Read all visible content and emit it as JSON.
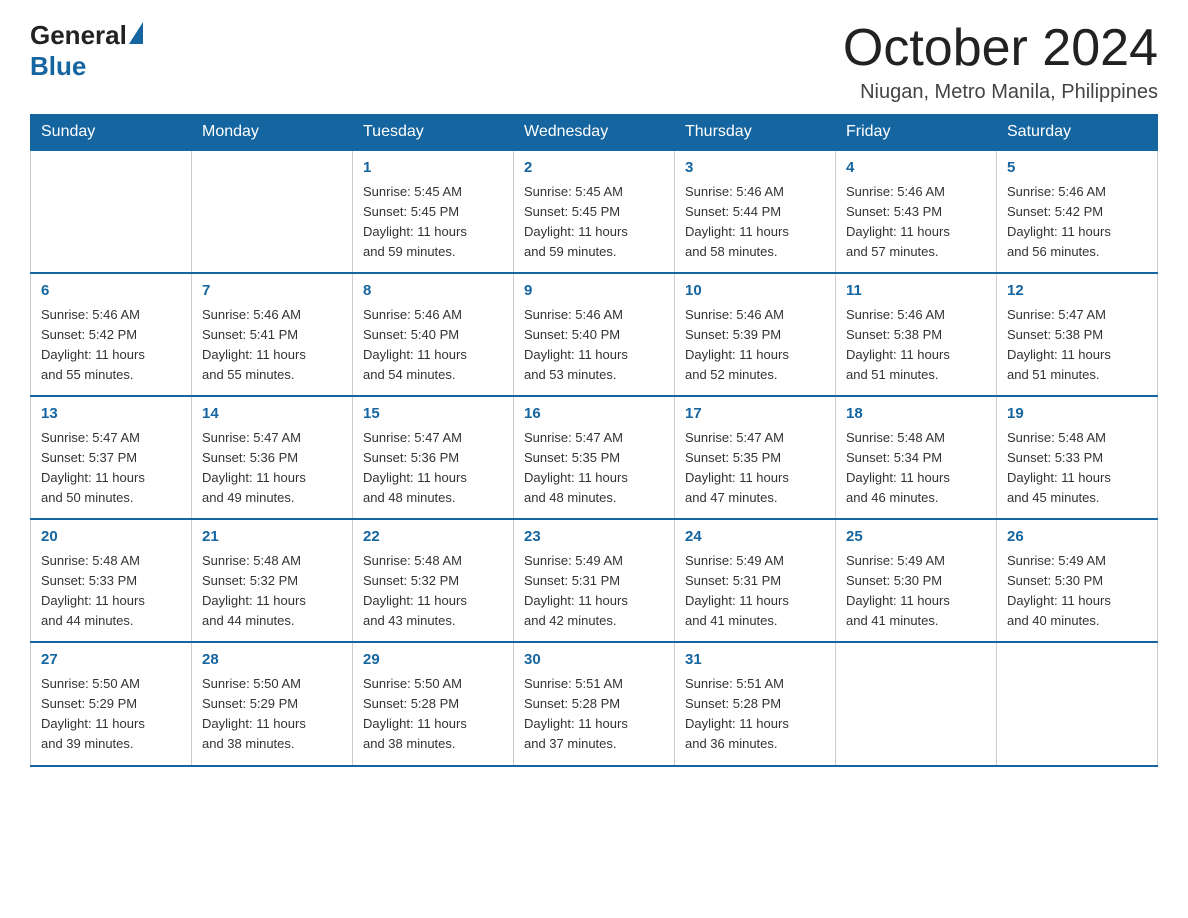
{
  "header": {
    "logo_general": "General",
    "logo_blue": "Blue",
    "month_title": "October 2024",
    "location": "Niugan, Metro Manila, Philippines"
  },
  "weekdays": [
    "Sunday",
    "Monday",
    "Tuesday",
    "Wednesday",
    "Thursday",
    "Friday",
    "Saturday"
  ],
  "weeks": [
    [
      {
        "day": "",
        "info": ""
      },
      {
        "day": "",
        "info": ""
      },
      {
        "day": "1",
        "info": "Sunrise: 5:45 AM\nSunset: 5:45 PM\nDaylight: 11 hours\nand 59 minutes."
      },
      {
        "day": "2",
        "info": "Sunrise: 5:45 AM\nSunset: 5:45 PM\nDaylight: 11 hours\nand 59 minutes."
      },
      {
        "day": "3",
        "info": "Sunrise: 5:46 AM\nSunset: 5:44 PM\nDaylight: 11 hours\nand 58 minutes."
      },
      {
        "day": "4",
        "info": "Sunrise: 5:46 AM\nSunset: 5:43 PM\nDaylight: 11 hours\nand 57 minutes."
      },
      {
        "day": "5",
        "info": "Sunrise: 5:46 AM\nSunset: 5:42 PM\nDaylight: 11 hours\nand 56 minutes."
      }
    ],
    [
      {
        "day": "6",
        "info": "Sunrise: 5:46 AM\nSunset: 5:42 PM\nDaylight: 11 hours\nand 55 minutes."
      },
      {
        "day": "7",
        "info": "Sunrise: 5:46 AM\nSunset: 5:41 PM\nDaylight: 11 hours\nand 55 minutes."
      },
      {
        "day": "8",
        "info": "Sunrise: 5:46 AM\nSunset: 5:40 PM\nDaylight: 11 hours\nand 54 minutes."
      },
      {
        "day": "9",
        "info": "Sunrise: 5:46 AM\nSunset: 5:40 PM\nDaylight: 11 hours\nand 53 minutes."
      },
      {
        "day": "10",
        "info": "Sunrise: 5:46 AM\nSunset: 5:39 PM\nDaylight: 11 hours\nand 52 minutes."
      },
      {
        "day": "11",
        "info": "Sunrise: 5:46 AM\nSunset: 5:38 PM\nDaylight: 11 hours\nand 51 minutes."
      },
      {
        "day": "12",
        "info": "Sunrise: 5:47 AM\nSunset: 5:38 PM\nDaylight: 11 hours\nand 51 minutes."
      }
    ],
    [
      {
        "day": "13",
        "info": "Sunrise: 5:47 AM\nSunset: 5:37 PM\nDaylight: 11 hours\nand 50 minutes."
      },
      {
        "day": "14",
        "info": "Sunrise: 5:47 AM\nSunset: 5:36 PM\nDaylight: 11 hours\nand 49 minutes."
      },
      {
        "day": "15",
        "info": "Sunrise: 5:47 AM\nSunset: 5:36 PM\nDaylight: 11 hours\nand 48 minutes."
      },
      {
        "day": "16",
        "info": "Sunrise: 5:47 AM\nSunset: 5:35 PM\nDaylight: 11 hours\nand 48 minutes."
      },
      {
        "day": "17",
        "info": "Sunrise: 5:47 AM\nSunset: 5:35 PM\nDaylight: 11 hours\nand 47 minutes."
      },
      {
        "day": "18",
        "info": "Sunrise: 5:48 AM\nSunset: 5:34 PM\nDaylight: 11 hours\nand 46 minutes."
      },
      {
        "day": "19",
        "info": "Sunrise: 5:48 AM\nSunset: 5:33 PM\nDaylight: 11 hours\nand 45 minutes."
      }
    ],
    [
      {
        "day": "20",
        "info": "Sunrise: 5:48 AM\nSunset: 5:33 PM\nDaylight: 11 hours\nand 44 minutes."
      },
      {
        "day": "21",
        "info": "Sunrise: 5:48 AM\nSunset: 5:32 PM\nDaylight: 11 hours\nand 44 minutes."
      },
      {
        "day": "22",
        "info": "Sunrise: 5:48 AM\nSunset: 5:32 PM\nDaylight: 11 hours\nand 43 minutes."
      },
      {
        "day": "23",
        "info": "Sunrise: 5:49 AM\nSunset: 5:31 PM\nDaylight: 11 hours\nand 42 minutes."
      },
      {
        "day": "24",
        "info": "Sunrise: 5:49 AM\nSunset: 5:31 PM\nDaylight: 11 hours\nand 41 minutes."
      },
      {
        "day": "25",
        "info": "Sunrise: 5:49 AM\nSunset: 5:30 PM\nDaylight: 11 hours\nand 41 minutes."
      },
      {
        "day": "26",
        "info": "Sunrise: 5:49 AM\nSunset: 5:30 PM\nDaylight: 11 hours\nand 40 minutes."
      }
    ],
    [
      {
        "day": "27",
        "info": "Sunrise: 5:50 AM\nSunset: 5:29 PM\nDaylight: 11 hours\nand 39 minutes."
      },
      {
        "day": "28",
        "info": "Sunrise: 5:50 AM\nSunset: 5:29 PM\nDaylight: 11 hours\nand 38 minutes."
      },
      {
        "day": "29",
        "info": "Sunrise: 5:50 AM\nSunset: 5:28 PM\nDaylight: 11 hours\nand 38 minutes."
      },
      {
        "day": "30",
        "info": "Sunrise: 5:51 AM\nSunset: 5:28 PM\nDaylight: 11 hours\nand 37 minutes."
      },
      {
        "day": "31",
        "info": "Sunrise: 5:51 AM\nSunset: 5:28 PM\nDaylight: 11 hours\nand 36 minutes."
      },
      {
        "day": "",
        "info": ""
      },
      {
        "day": "",
        "info": ""
      }
    ]
  ]
}
